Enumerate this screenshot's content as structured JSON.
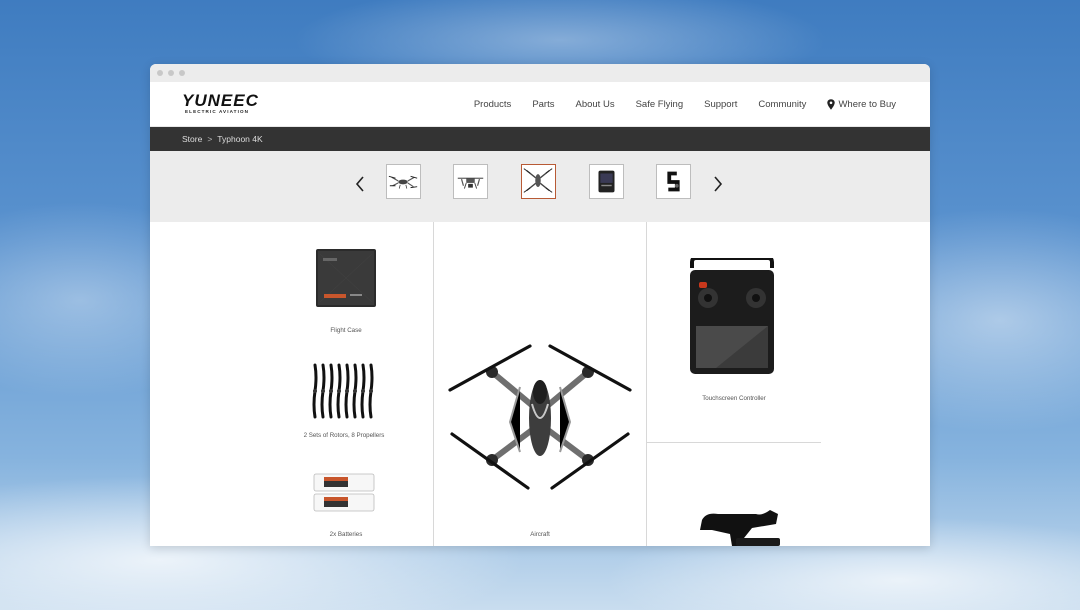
{
  "brand": {
    "name": "YUNEEC",
    "tagline": "ELECTRIC AVIATION"
  },
  "nav": {
    "items": [
      "Products",
      "Parts",
      "About Us",
      "Safe Flying",
      "Support",
      "Community"
    ],
    "where_to_buy": "Where to Buy"
  },
  "breadcrumb": {
    "items": [
      "Store",
      "Typhoon 4K"
    ],
    "separator": ">"
  },
  "thumbnails": {
    "count": 5,
    "active_index": 2,
    "icons": [
      "drone-side-thumb",
      "drone-front-thumb",
      "drone-top-thumb",
      "battery-thumb",
      "gimbal-thumb"
    ]
  },
  "products": {
    "flight_case": "Flight Case",
    "rotors": "2 Sets of Rotors, 8 Propellers",
    "batteries": "2x Batteries",
    "aircraft": "Aircraft",
    "controller": "Touchscreen Controller"
  },
  "colors": {
    "breadcrumb_bg": "#333333",
    "active_thumb_border": "#b85a35",
    "sky_top": "#3f7cc0"
  }
}
